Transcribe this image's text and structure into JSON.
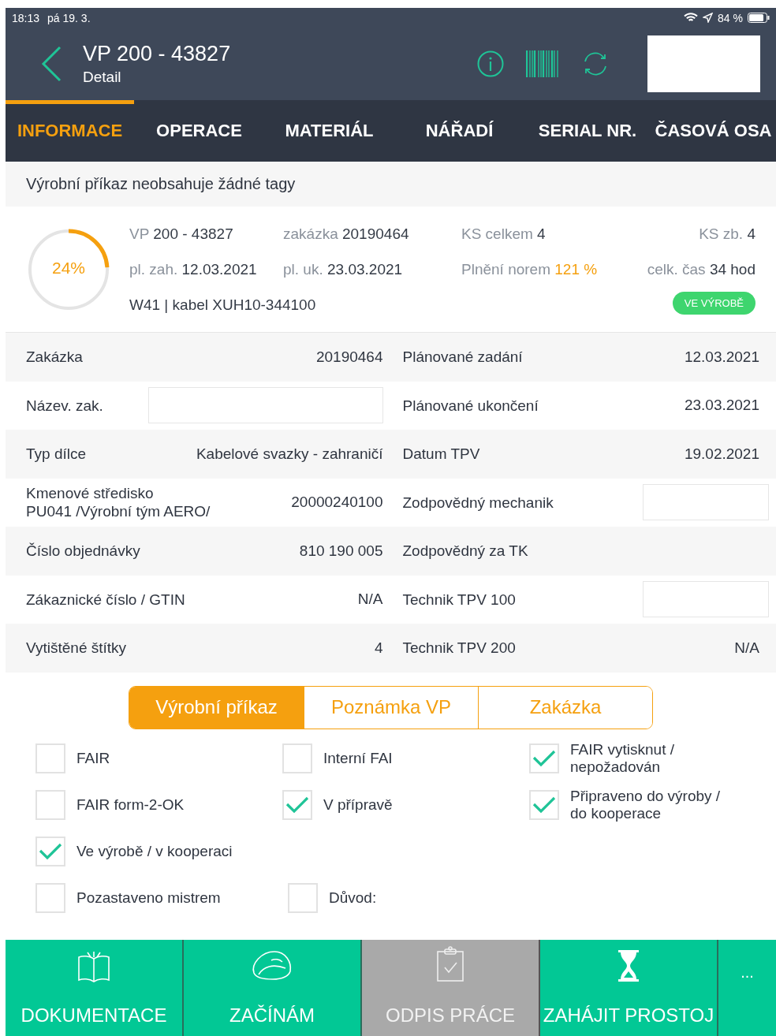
{
  "status_bar": {
    "time": "18:13",
    "date": "pá 19. 3.",
    "battery": "84 %"
  },
  "header": {
    "title": "VP 200 - 43827",
    "subtitle": "Detail"
  },
  "tabs": [
    {
      "label": "INFORMACE",
      "selected": true
    },
    {
      "label": "OPERACE",
      "selected": false
    },
    {
      "label": "MATERIÁL",
      "selected": false
    },
    {
      "label": "NÁŘADÍ",
      "selected": false
    },
    {
      "label": "SERIAL NR.",
      "selected": false
    },
    {
      "label": "ČASOVÁ OSA",
      "selected": false
    }
  ],
  "tags_message": "Výrobní příkaz neobsahuje žádné tagy",
  "summary": {
    "progress": {
      "label": "24%"
    },
    "fields": [
      {
        "label": "VP",
        "value": "200 - 43827",
        "accent": false
      },
      {
        "label": "zakázka",
        "value": "20190464",
        "accent": false
      },
      {
        "label": "KS celkem",
        "value": "4",
        "accent": false
      },
      {
        "label": "KS zb.",
        "value": "4",
        "accent": false
      },
      {
        "label": "pl. zah.",
        "value": "12.03.2021",
        "accent": false
      },
      {
        "label": "pl. uk.",
        "value": "23.03.2021",
        "accent": false
      },
      {
        "label": "Plnění norem",
        "value": "121 %",
        "accent": true
      },
      {
        "label": "celk. čas",
        "value": "34 hod",
        "accent": false
      }
    ],
    "part": "W41 | kabel XUH10-344100",
    "status_badge": "VE VÝROBĚ"
  },
  "details": [
    {
      "cells": [
        {
          "label": "Zakázka",
          "value": "20190464"
        },
        {
          "label": "Plánované zadání",
          "value": "12.03.2021"
        }
      ]
    },
    {
      "cells": [
        {
          "label": "Název. zak.",
          "blank": true
        },
        {
          "label": "Plánované ukončení",
          "value": "23.03.2021"
        }
      ]
    },
    {
      "cells": [
        {
          "label": "Typ dílce",
          "value": "Kabelové svazky - zahraničí"
        },
        {
          "label": "Datum TPV",
          "value": "19.02.2021"
        }
      ]
    },
    {
      "cells": [
        {
          "label": "Kmenové středisko\nPU041   /Výrobní tým AERO/",
          "value": "20000240100"
        },
        {
          "label": "Zodpovědný mechanik",
          "blank": true
        }
      ]
    },
    {
      "cells": [
        {
          "label": "Číslo objednávky",
          "value": "810 190 005"
        },
        {
          "label": "Zodpovědný za TK"
        }
      ]
    },
    {
      "cells": [
        {
          "label": "Zákaznické číslo / GTIN",
          "value": "N/A"
        },
        {
          "label": "Technik TPV 100",
          "blank": true
        }
      ]
    },
    {
      "cells": [
        {
          "label": "Vytištěné štítky",
          "value": "4"
        },
        {
          "label": "Technik TPV 200",
          "value": "N/A"
        }
      ]
    }
  ],
  "segments": [
    {
      "label": "Výrobní příkaz",
      "selected": true
    },
    {
      "label": "Poznámka VP",
      "selected": false
    },
    {
      "label": "Zakázka",
      "selected": false
    }
  ],
  "checkbox_rows": [
    [
      {
        "label": "FAIR",
        "checked": false
      },
      {
        "label": "Interní FAI",
        "checked": false
      },
      {
        "label": "FAIR vytisknut /\nnepožadován",
        "checked": true
      }
    ],
    [
      {
        "label": "FAIR form-2-OK",
        "checked": false
      },
      {
        "label": "V přípravě",
        "checked": true
      },
      {
        "label": "Připraveno do výroby /\ndo kooperace",
        "checked": true
      }
    ],
    [
      {
        "label": "Ve výrobě / v kooperaci",
        "checked": true
      }
    ],
    [
      {
        "label": "Pozastaveno mistrem",
        "checked": false
      },
      {
        "label": "Důvod:",
        "checked": false
      }
    ]
  ],
  "actions": [
    {
      "label": "DOKUMENTACE",
      "kind": "book",
      "disabled": false
    },
    {
      "label": "ZAČÍNÁM",
      "kind": "helmet",
      "disabled": false
    },
    {
      "label": "ODPIS PRÁCE",
      "kind": "clipboard",
      "disabled": true
    },
    {
      "label": "ZAHÁJIT PROSTOJ",
      "kind": "hourglass",
      "disabled": false
    }
  ],
  "more": "..."
}
